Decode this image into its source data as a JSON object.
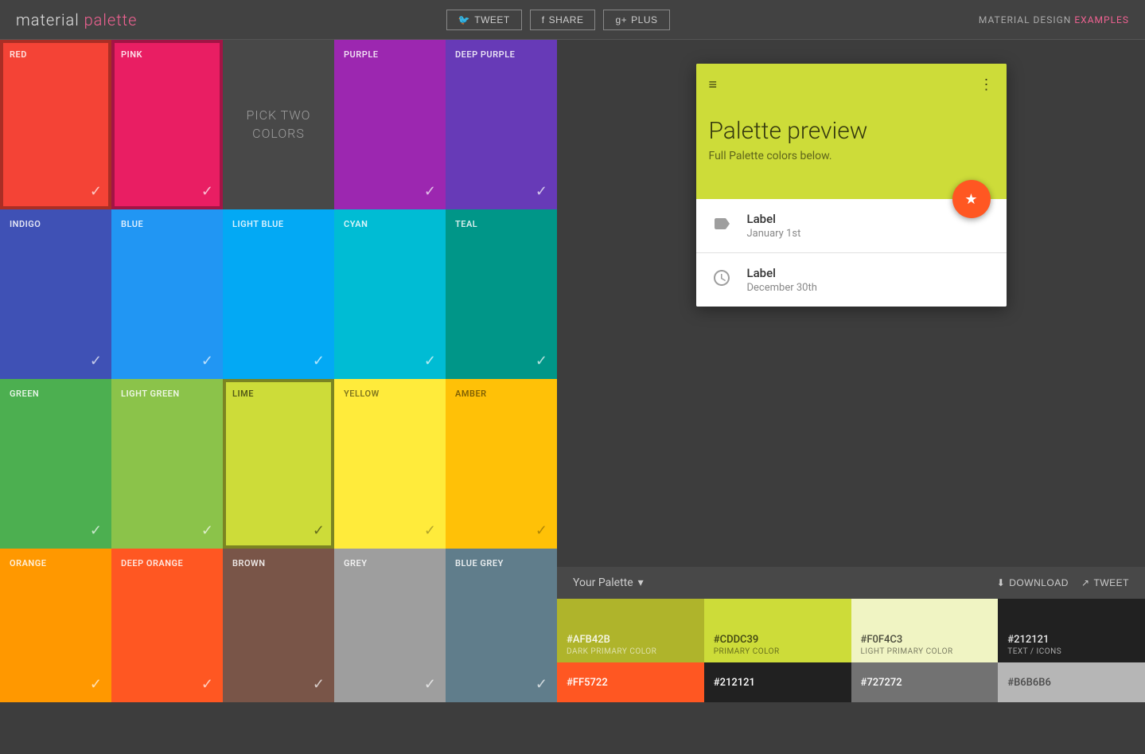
{
  "header": {
    "logo_text": "material",
    "logo_accent": "palette",
    "tweet_label": "TWEET",
    "share_label": "SHARE",
    "plus_label": "PLUS",
    "design_label": "MATERIAL DESIGN",
    "examples_label": "EXAMPLES"
  },
  "pick_two": {
    "text": "PICK TWO\nCOLORS"
  },
  "colors": [
    {
      "name": "RED",
      "bg": "#f44336",
      "selected": true,
      "row": 0
    },
    {
      "name": "PINK",
      "bg": "#e91e63",
      "selected": true,
      "row": 0
    },
    {
      "name": "PURPLE",
      "bg": "#9c27b0",
      "selected": false,
      "row": 0
    },
    {
      "name": "DEEP PURPLE",
      "bg": "#673ab7",
      "selected": false,
      "row": 0
    },
    {
      "name": "INDIGO",
      "bg": "#3f51b5",
      "selected": false,
      "row": 1
    },
    {
      "name": "BLUE",
      "bg": "#2196f3",
      "selected": false,
      "row": 1
    },
    {
      "name": "LIGHT BLUE",
      "bg": "#03a9f4",
      "selected": false,
      "row": 1
    },
    {
      "name": "CYAN",
      "bg": "#00bcd4",
      "selected": false,
      "row": 1
    },
    {
      "name": "TEAL",
      "bg": "#009688",
      "selected": false,
      "row": 1
    },
    {
      "name": "GREEN",
      "bg": "#4caf50",
      "selected": false,
      "row": 2
    },
    {
      "name": "LIGHT GREEN",
      "bg": "#8bc34a",
      "selected": false,
      "row": 2
    },
    {
      "name": "LIME",
      "bg": "#cddc39",
      "selected": true,
      "row": 2
    },
    {
      "name": "YELLOW",
      "bg": "#ffeb3b",
      "selected": false,
      "row": 2
    },
    {
      "name": "AMBER",
      "bg": "#ffc107",
      "selected": false,
      "row": 2
    },
    {
      "name": "ORANGE",
      "bg": "#ff9800",
      "selected": false,
      "row": 3
    },
    {
      "name": "DEEP ORANGE",
      "bg": "#ff5722",
      "selected": false,
      "row": 3
    },
    {
      "name": "BROWN",
      "bg": "#795548",
      "selected": false,
      "row": 3
    },
    {
      "name": "GREY",
      "bg": "#9e9e9e",
      "selected": false,
      "row": 3
    },
    {
      "name": "BLUE GREY",
      "bg": "#607d8b",
      "selected": false,
      "row": 3
    }
  ],
  "preview": {
    "title": "Palette preview",
    "subtitle": "Full Palette colors below.",
    "header_bg": "#CDDC39",
    "fab_color": "#FF5722",
    "list_items": [
      {
        "icon": "label",
        "label": "Label",
        "sublabel": "January 1st"
      },
      {
        "icon": "clock",
        "label": "Label",
        "sublabel": "December 30th"
      }
    ]
  },
  "palette": {
    "your_palette_label": "Your Palette",
    "download_label": "DOWNLOAD",
    "tweet_label": "TWEET",
    "colors_row1": [
      {
        "hex": "#AFB42B",
        "label": "DARK PRIMARY COLOR",
        "bg": "#AFB42B",
        "text_dark": false
      },
      {
        "hex": "#CDDC39",
        "label": "PRIMARY COLOR",
        "bg": "#CDDC39",
        "text_dark": true
      },
      {
        "hex": "#F0F4C3",
        "label": "LIGHT PRIMARY COLOR",
        "bg": "#F0F4C3",
        "text_dark": true
      },
      {
        "hex": "#212121",
        "label": "TEXT / ICONS",
        "bg": "#212121",
        "text_dark": false
      }
    ],
    "colors_row2": [
      {
        "hex": "#FF5722",
        "bg": "#FF5722",
        "text_dark": false
      },
      {
        "hex": "#212121",
        "bg": "#212121",
        "text_dark": false
      },
      {
        "hex": "#727272",
        "bg": "#727272",
        "text_dark": false
      },
      {
        "hex": "#B6B6B6",
        "bg": "#B6B6B6",
        "text_dark": true
      }
    ]
  }
}
